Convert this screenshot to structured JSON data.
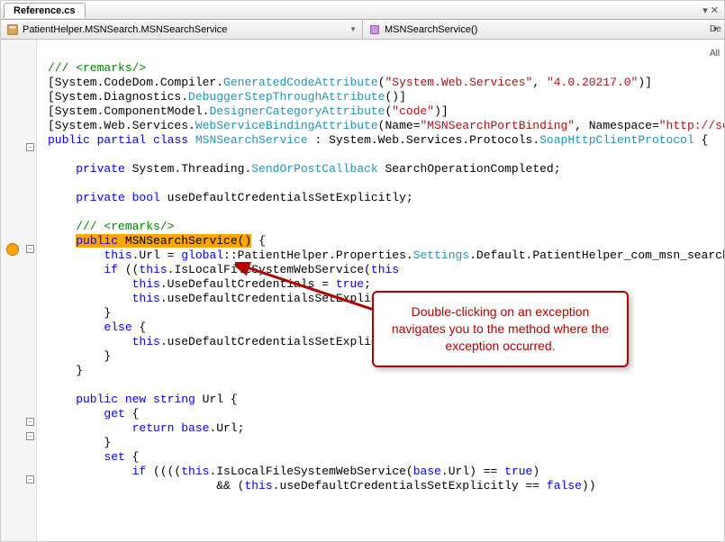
{
  "file_tab": {
    "name": "Reference.cs"
  },
  "nav": {
    "left": {
      "label": "PatientHelper.MSNSearch.MSNSearchService"
    },
    "right": {
      "label": "MSNSearchService()"
    }
  },
  "callout": {
    "text": "Double-clicking on an exception navigates you to the method where the exception occurred."
  },
  "code": {
    "l0": "/// <remarks/>",
    "l1a": "[System.CodeDom.Compiler.",
    "l1b": "GeneratedCodeAttribute",
    "l1c": "(",
    "l1d": "\"System.Web.Services\"",
    "l1e": ", ",
    "l1f": "\"4.0.20217.0\"",
    "l1g": ")]",
    "l2a": "[System.Diagnostics.",
    "l2b": "DebuggerStepThroughAttribute",
    "l2c": "()]",
    "l3a": "[System.ComponentModel.",
    "l3b": "DesignerCategoryAttribute",
    "l3c": "(",
    "l3d": "\"code\"",
    "l3e": ")]",
    "l4a": "[System.Web.Services.",
    "l4b": "WebServiceBindingAttribute",
    "l4c": "(Name=",
    "l4d": "\"MSNSearchPortBinding\"",
    "l4e": ", Namespace=",
    "l4f": "\"http://schem",
    "l5a": "public",
    "l5b": " partial",
    "l5c": " class",
    "l5d": " MSNSearchService",
    "l5e": " : System.Web.Services.Protocols.",
    "l5f": "SoapHttpClientProtocol",
    "l5g": " {",
    "l6": "",
    "l7a": "    private",
    "l7b": " System.Threading.",
    "l7c": "SendOrPostCallback",
    "l7d": " SearchOperationCompleted;",
    "l8": "",
    "l9a": "    private",
    "l9b": " bool",
    "l9c": " useDefaultCredentialsSetExplicitly;",
    "l10": "",
    "l11": "    /// <remarks/>",
    "l12a": "    ",
    "l12b": "public",
    "l12c": " MSNSearchService()",
    "l12d": " {",
    "l13a": "        this",
    "l13b": ".Url = ",
    "l13c": "global",
    "l13d": "::PatientHelper.Properties.",
    "l13e": "Settings",
    "l13f": ".Default.PatientHelper_com_msn_search_so",
    "l14a": "        if",
    "l14b": " ((",
    "l14c": "this",
    "l14d": ".IsLocalFileSystemWebService(",
    "l14e": "this",
    "l15a": "            this",
    "l15b": ".UseDefaultCredentials = ",
    "l15c": "true",
    "l15d": ";",
    "l16a": "            this",
    "l16b": ".useDefaultCredentialsSetExplicit",
    "l17": "        }",
    "l18a": "        else",
    "l18b": " {",
    "l19a": "            this",
    "l19b": ".useDefaultCredentialsSetExplicit",
    "l20": "        }",
    "l21": "    }",
    "l22": "",
    "l23a": "    public",
    "l23b": " new",
    "l23c": " string",
    "l23d": " Url {",
    "l24a": "        get",
    "l24b": " {",
    "l25a": "            return",
    "l25b": " base",
    "l25c": ".Url;",
    "l26": "        }",
    "l27a": "        set",
    "l27b": " {",
    "l28a": "            if",
    "l28b": " ((((",
    "l28c": "this",
    "l28d": ".IsLocalFileSystemWebService(",
    "l28e": "base",
    "l28f": ".Url) == ",
    "l28g": "true",
    "l28h": ")",
    "l29a": "                        && (",
    "l29b": "this",
    "l29c": ".useDefaultCredentialsSetExplicitly == ",
    "l29d": "false",
    "l29e": "))"
  },
  "side": {
    "a": "De",
    "b": "All"
  }
}
